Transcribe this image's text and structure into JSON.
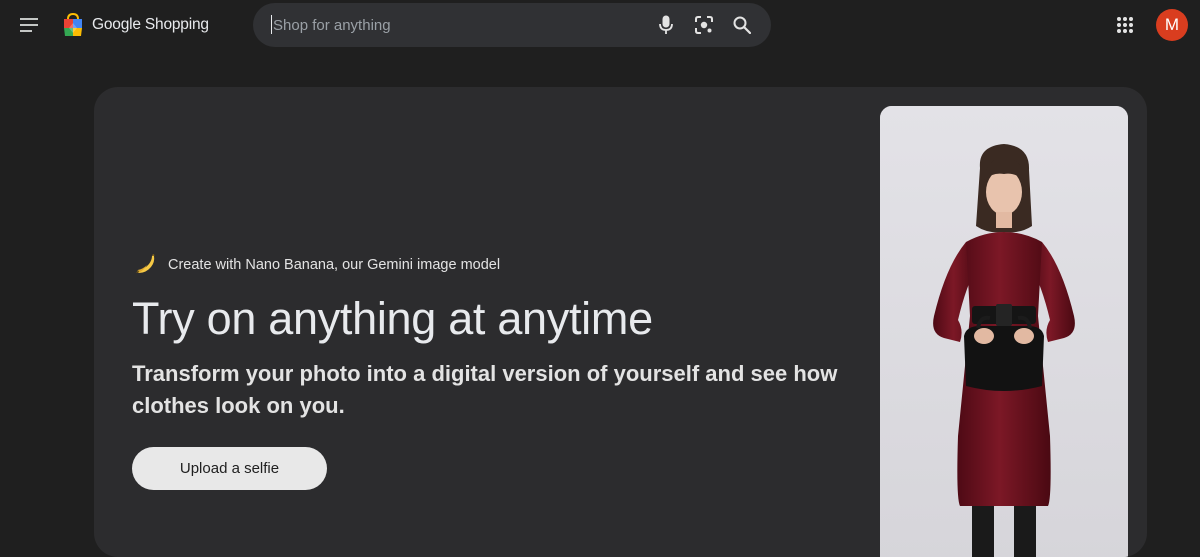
{
  "header": {
    "logo_text": "Google Shopping",
    "search_placeholder": "Shop for anything",
    "avatar_initial": "M"
  },
  "hero": {
    "promo_text": "Create with Nano Banana, our Gemini image model",
    "headline": "Try on anything at anytime",
    "subhead": "Transform your photo into a digital version of yourself and see how clothes look on you.",
    "upload_label": "Upload a selfie"
  },
  "icons": {
    "menu": "menu-icon",
    "logo": "shopping-bag-logo",
    "mic": "microphone-icon",
    "lens": "lens-camera-icon",
    "search": "search-icon",
    "apps": "apps-grid-icon",
    "promo": "banana-icon"
  },
  "colors": {
    "background": "#1f1f1f",
    "card": "#2c2c2e",
    "search_bg": "#303134",
    "avatar": "#d93d1f",
    "button_bg": "#e8e8e8",
    "dress": "#6e1220"
  }
}
